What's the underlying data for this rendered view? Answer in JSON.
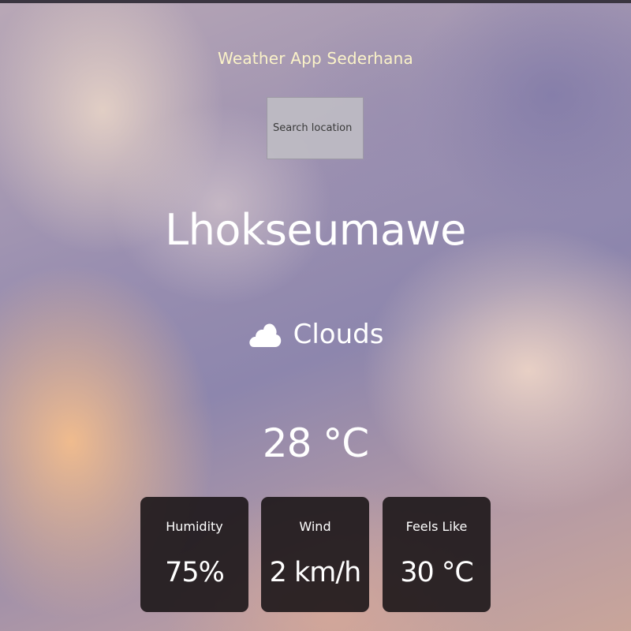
{
  "app": {
    "title": "Weather App Sederhana"
  },
  "search": {
    "placeholder": "Search location",
    "value": ""
  },
  "weather": {
    "city": "Lhokseumawe",
    "condition": "Clouds",
    "condition_icon": "cloud-icon",
    "temperature": "28 °C"
  },
  "details": {
    "humidity": {
      "label": "Humidity",
      "value": "75%"
    },
    "wind": {
      "label": "Wind",
      "value": "2 km/h"
    },
    "feels_like": {
      "label": "Feels Like",
      "value": "30 °C"
    }
  },
  "colors": {
    "title": "#fbf3c8",
    "card_bg": "#1c1618",
    "text": "#ffffff"
  }
}
